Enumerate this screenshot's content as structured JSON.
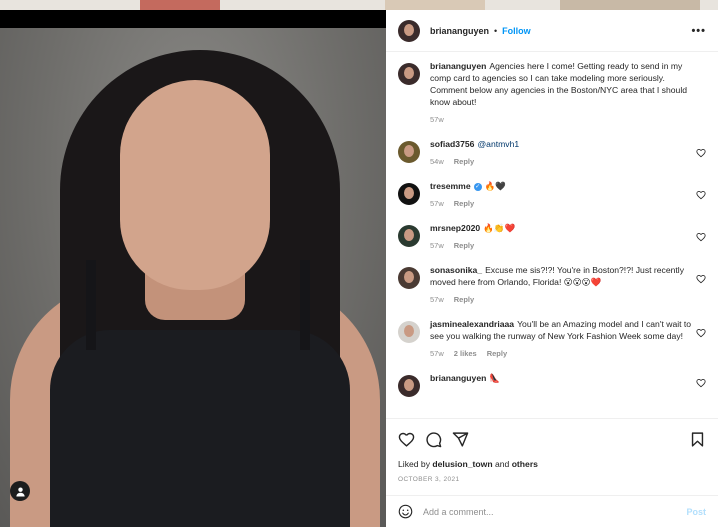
{
  "post": {
    "author": "briananguyen",
    "follow_label": "Follow",
    "separator": "•",
    "caption": "Agencies here I come! Getting ready to send in my comp card to agencies so I can take modeling more seriously. Comment below any agencies in the Boston/NYC area that I should know about!",
    "caption_time": "57w",
    "liked_prefix": "Liked by",
    "liked_user": "delusion_town",
    "liked_conjunction": "and",
    "liked_others": "others",
    "date": "OCTOBER 3, 2021"
  },
  "comments": [
    {
      "user": "sofiad3756",
      "text": "",
      "mention": "@antmvh1",
      "time": "54w",
      "reply_label": "Reply",
      "likes": ""
    },
    {
      "user": "tresemme",
      "verified": true,
      "text": "🔥🖤",
      "time": "57w",
      "reply_label": "Reply",
      "likes": ""
    },
    {
      "user": "mrsnep2020",
      "text": "🔥👏❤️",
      "time": "57w",
      "reply_label": "Reply",
      "likes": ""
    },
    {
      "user": "sonasonika_",
      "text": "Excuse me sis?!?! You're in Boston?!?! Just recently moved here from Orlando, Florida! 😮😮😮❤️",
      "time": "57w",
      "reply_label": "Reply",
      "likes": ""
    },
    {
      "user": "jasminealexandriaaa",
      "text": "You'll be an Amazing model and I can't wait to see you walking the runway of New York Fashion Week some day!",
      "time": "57w",
      "reply_label": "Reply",
      "likes": "2 likes"
    },
    {
      "user": "briananguyen",
      "text": "👠",
      "time": "",
      "reply_label": "",
      "likes": ""
    }
  ],
  "add_comment": {
    "placeholder": "Add a comment...",
    "post_label": "Post"
  },
  "icons": {
    "more": "more-options-icon",
    "heart": "heart-icon",
    "comment": "comment-icon",
    "share": "share-icon",
    "save": "bookmark-icon",
    "emoji": "emoji-icon",
    "user_tag": "user-tag-icon"
  },
  "colors": {
    "accent": "#0095f6",
    "text": "#262626",
    "muted": "#8e8e8e",
    "post_disabled": "#b2dffc"
  }
}
